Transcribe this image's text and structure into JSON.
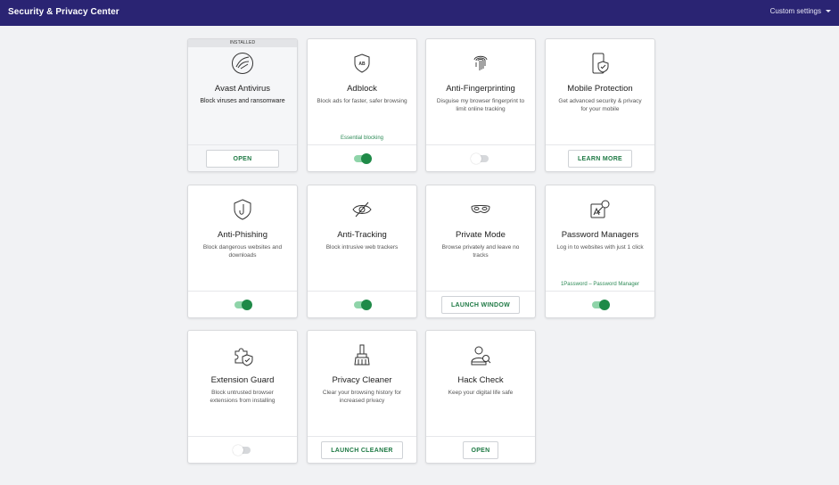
{
  "header": {
    "title": "Security & Privacy Center",
    "settings_label": "Custom settings"
  },
  "colors": {
    "header_bg": "#2a2473",
    "accent_green": "#1f8a48"
  },
  "cards": [
    {
      "name": "Avast Antivirus",
      "desc": "Block viruses and ransomware",
      "badge": "INSTALLED",
      "icon": "antivirus-icon",
      "action": "button",
      "button_label": "OPEN"
    },
    {
      "name": "Adblock",
      "desc": "Block ads for faster, safer browsing",
      "note": "Essential blocking",
      "icon": "adblock-icon",
      "action": "toggle",
      "toggle_on": true
    },
    {
      "name": "Anti-Fingerprinting",
      "desc": "Disguise my browser fingerprint to limit online tracking",
      "icon": "fingerprint-icon",
      "action": "toggle",
      "toggle_on": false
    },
    {
      "name": "Mobile Protection",
      "desc": "Get advanced security & privacy for your mobile",
      "icon": "mobile-shield-icon",
      "action": "button",
      "button_label": "LEARN MORE"
    },
    {
      "name": "Anti-Phishing",
      "desc": "Block dangerous websites and downloads",
      "icon": "phishing-hook-icon",
      "action": "toggle",
      "toggle_on": true
    },
    {
      "name": "Anti-Tracking",
      "desc": "Block intrusive web trackers",
      "icon": "eye-off-icon",
      "action": "toggle",
      "toggle_on": true
    },
    {
      "name": "Private Mode",
      "desc": "Browse privately and leave no tracks",
      "icon": "mask-icon",
      "action": "button",
      "button_label": "LAUNCH WINDOW"
    },
    {
      "name": "Password Managers",
      "desc": "Log in to websites with just 1 click",
      "note": "1Password – Password Manager",
      "icon": "password-key-icon",
      "action": "toggle",
      "toggle_on": true
    },
    {
      "name": "Extension Guard",
      "desc": "Block untrusted browser extensions from installing",
      "icon": "extension-shield-icon",
      "action": "toggle",
      "toggle_on": false
    },
    {
      "name": "Privacy Cleaner",
      "desc": "Clear your browsing history for increased privacy",
      "icon": "broom-icon",
      "action": "button",
      "button_label": "LAUNCH CLEANER"
    },
    {
      "name": "Hack Check",
      "desc": "Keep your digital life safe",
      "icon": "hack-check-icon",
      "action": "button",
      "button_label": "OPEN"
    }
  ]
}
